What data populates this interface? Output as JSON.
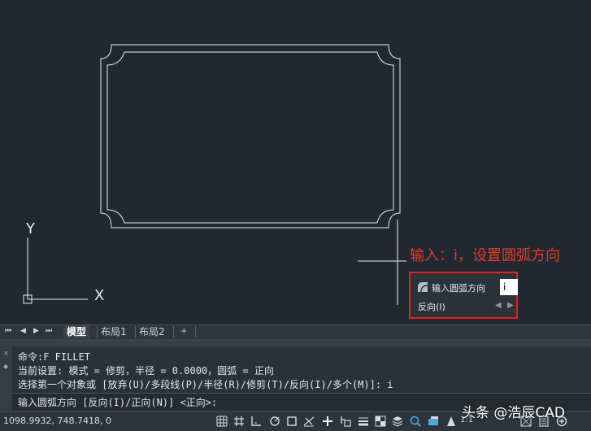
{
  "annotation": "输入：i，设置圆弧方向",
  "prompt": {
    "label": "输入圆弧方向",
    "value": "i",
    "option": "反向(I)"
  },
  "ucs": {
    "y_label": "Y",
    "x_label": "X"
  },
  "tabs": [
    {
      "label": "模型",
      "active": true
    },
    {
      "label": "布局1",
      "active": false
    },
    {
      "label": "布局2",
      "active": false
    },
    {
      "label": "+",
      "active": false
    }
  ],
  "command_history": [
    "命令:F FILLET",
    "当前设置: 模式 = 修剪，半径 = 0.0000，圆弧 = 正向",
    "选择第一个对象或 [放弃(U)/多段线(P)/半径(R)/修剪(T)/反向(I)/多个(M)]: i"
  ],
  "command_input": "输入圆弧方向 [反向(I)/正向(N)] <正向>:",
  "status": {
    "coordinates": "1098.9932, 748.7418, 0",
    "scale": "1:1"
  },
  "watermark": "头条 @浩辰CAD",
  "colors": {
    "background": "#212830",
    "annotation": "#e33a2c",
    "highlight_border": "#e0231b"
  }
}
